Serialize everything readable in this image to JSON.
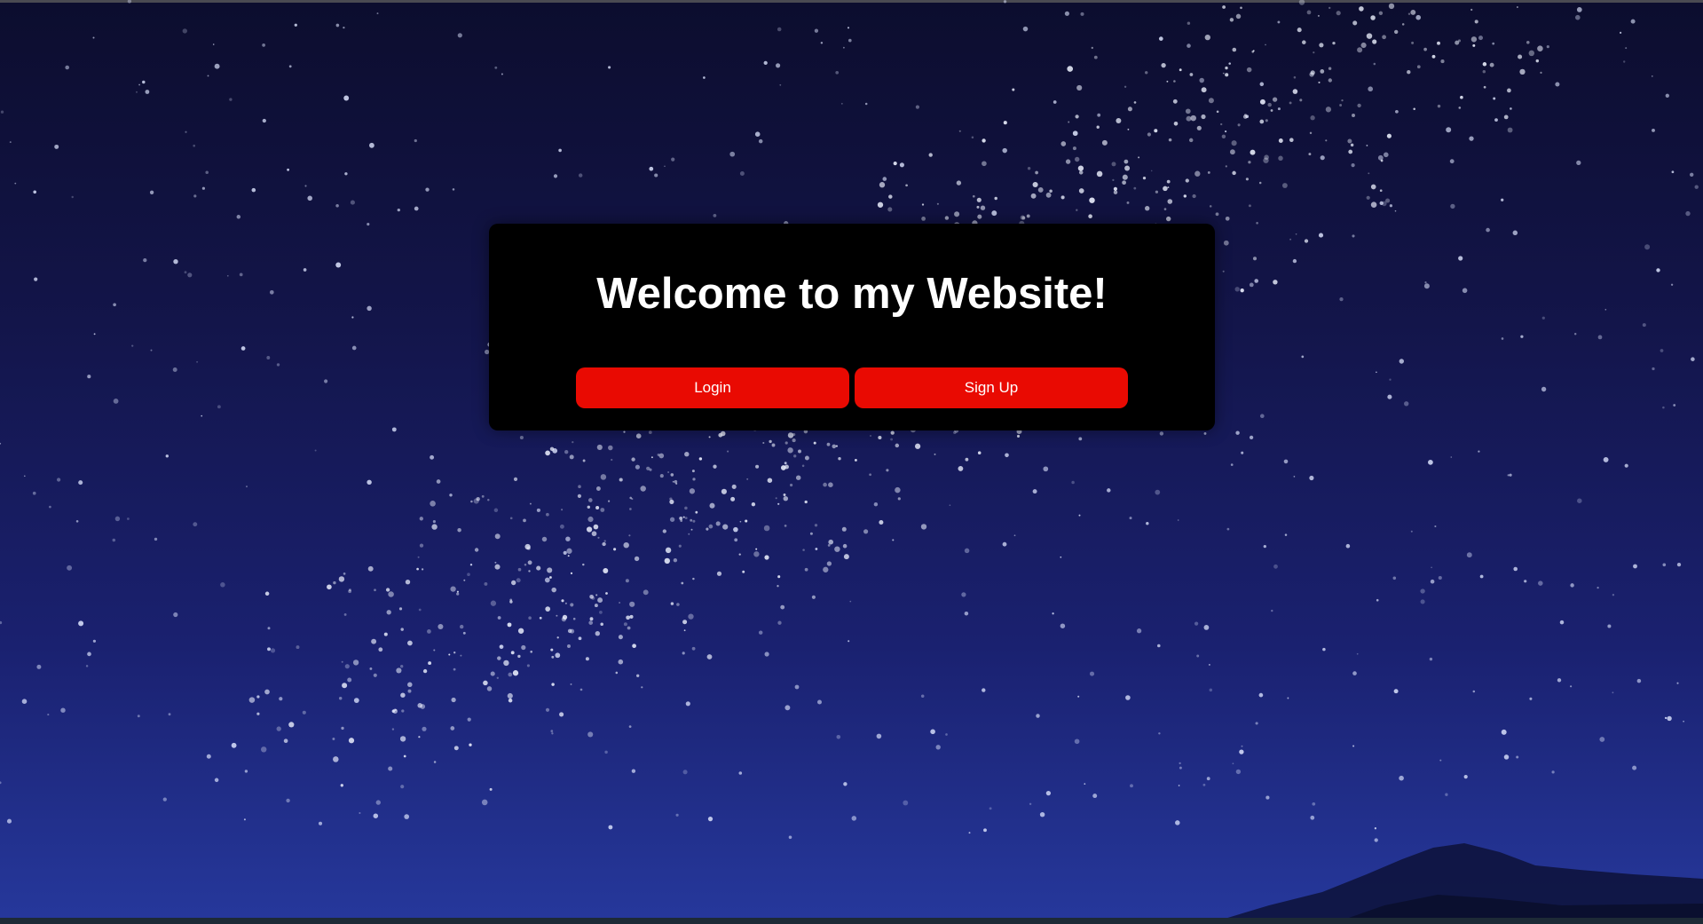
{
  "hero": {
    "title": "Welcome to my Website!"
  },
  "actions": {
    "login_label": "Login",
    "signup_label": "Sign Up"
  },
  "colors": {
    "card_background": "#000000",
    "button_background": "#e90a02",
    "button_text": "#ffffff",
    "title_text": "#ffffff",
    "sky_top": "#0c0d2e",
    "sky_bottom": "#26389c"
  },
  "background": {
    "description_icon": "starry-night-sky"
  }
}
